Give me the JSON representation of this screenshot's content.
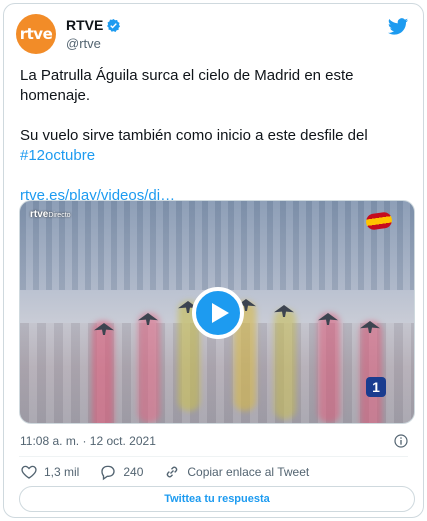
{
  "header": {
    "avatar_text": "rtve",
    "display_name": "RTVE",
    "handle": "@rtve"
  },
  "tweet": {
    "line1": "La Patrulla Águila surca el cielo de Madrid en este homenaje.",
    "line2_text": "Su vuelo sirve también como inicio a este desfile del ",
    "hashtag": "#12octubre",
    "link": "rtve.es/play/videos/di…"
  },
  "media": {
    "overlay_brand": "rtve",
    "overlay_live": "Directo",
    "channel_badge": "1"
  },
  "meta": {
    "timestamp": "11:08 a. m. · 12 oct. 2021"
  },
  "actions": {
    "likes": "1,3 mil",
    "replies": "240",
    "copy_link": "Copiar enlace al Tweet"
  },
  "reply_button": "Twittea tu respuesta",
  "colors": {
    "accent": "#1d9bf0",
    "brand_orange": "#f28c28",
    "secondary_text": "#536471"
  },
  "icons": [
    "verified-icon",
    "twitter-bird-icon",
    "play-icon",
    "info-icon",
    "heart-icon",
    "reply-icon",
    "link-icon"
  ]
}
